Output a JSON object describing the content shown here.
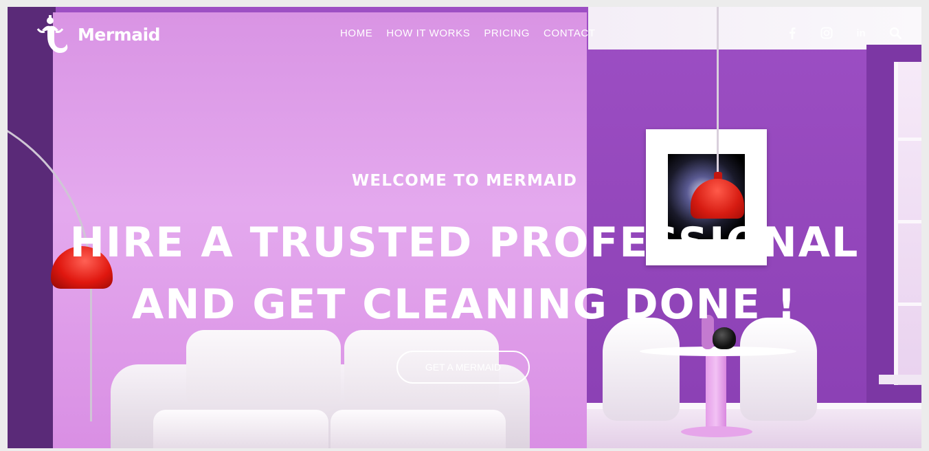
{
  "brand": {
    "name": "Mermaid",
    "logo_icon": "mermaid-logo-icon"
  },
  "nav": {
    "items": [
      {
        "label": "HOME"
      },
      {
        "label": "HOW IT WORKS"
      },
      {
        "label": "PRICING"
      },
      {
        "label": "CONTACT"
      }
    ]
  },
  "social": {
    "facebook_icon": "facebook-icon",
    "instagram_icon": "instagram-icon",
    "linkedin_icon": "linkedin-icon",
    "search_icon": "search-icon",
    "linkedin_glyph": "in"
  },
  "hero": {
    "subtitle": "WELCOME TO MERMAID",
    "title_line1": "HIRE A TRUSTED PROFESSIONAL",
    "title_line2": "AND GET CLEANING DONE !",
    "cta_label": "GET A MERMAID"
  },
  "colors": {
    "wall": "#8e45b6",
    "panel": "#e0a2ea",
    "lamp_red": "#d71c12",
    "text": "#ffffff"
  }
}
